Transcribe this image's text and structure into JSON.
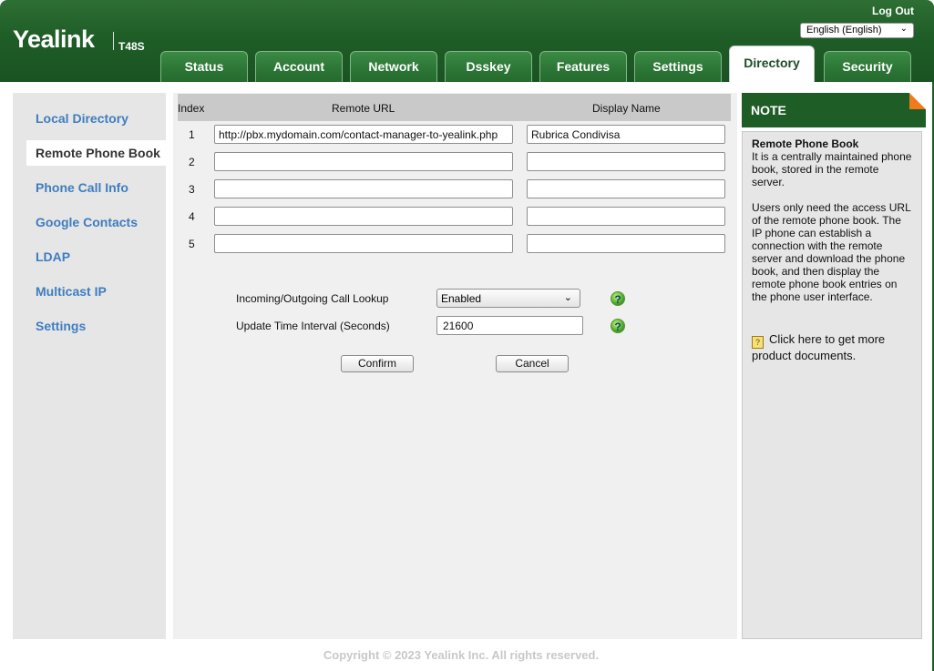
{
  "header": {
    "brand": "Yealink",
    "model": "T48S",
    "logout": "Log Out",
    "language": "English (English)"
  },
  "tabs": [
    {
      "label": "Status"
    },
    {
      "label": "Account"
    },
    {
      "label": "Network"
    },
    {
      "label": "Dsskey"
    },
    {
      "label": "Features"
    },
    {
      "label": "Settings"
    },
    {
      "label": "Directory",
      "active": true
    },
    {
      "label": "Security"
    }
  ],
  "sidebar": {
    "items": [
      {
        "label": "Local Directory"
      },
      {
        "label": "Remote Phone Book",
        "active": true
      },
      {
        "label": "Phone Call Info"
      },
      {
        "label": "Google Contacts"
      },
      {
        "label": "LDAP"
      },
      {
        "label": "Multicast IP"
      },
      {
        "label": "Settings"
      }
    ]
  },
  "table": {
    "headers": {
      "index": "Index",
      "url": "Remote URL",
      "name": "Display Name"
    },
    "rows": [
      {
        "index": "1",
        "url": "http://pbx.mydomain.com/contact-manager-to-yealink.php",
        "name": "Rubrica Condivisa"
      },
      {
        "index": "2",
        "url": "",
        "name": ""
      },
      {
        "index": "3",
        "url": "",
        "name": ""
      },
      {
        "index": "4",
        "url": "",
        "name": ""
      },
      {
        "index": "5",
        "url": "",
        "name": ""
      }
    ]
  },
  "form": {
    "lookup_label": "Incoming/Outgoing Call Lookup",
    "lookup_value": "Enabled",
    "interval_label": "Update Time Interval (Seconds)",
    "interval_value": "21600",
    "confirm": "Confirm",
    "cancel": "Cancel",
    "help_glyph": "?"
  },
  "note": {
    "heading": "NOTE",
    "title": "Remote Phone Book",
    "p1": "It is a centrally maintained phone book, stored in the remote server.",
    "p2": "Users only need the access URL of the remote phone book. The IP phone can establish a connection with the remote server and download the phone book, and then display the remote phone book entries on the phone user interface.",
    "link": "Click here to get more product documents."
  },
  "footer": "Copyright © 2023 Yealink Inc. All rights reserved."
}
